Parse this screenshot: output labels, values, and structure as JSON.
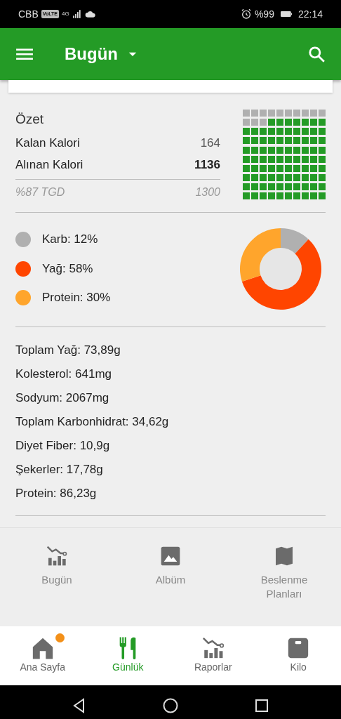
{
  "status_bar": {
    "carrier": "CBB",
    "volte": "VoLTE",
    "network": "4G",
    "battery_text": "%99",
    "time": "22:14"
  },
  "app_bar": {
    "title": "Bugün"
  },
  "summary": {
    "title": "Özet",
    "rows": [
      {
        "label": "Kalan Kalori",
        "value": "164",
        "emphasis": false
      },
      {
        "label": "Alınan Kalori",
        "value": "1136",
        "emphasis": true
      }
    ],
    "footer_label": "%87 TGD",
    "footer_value": "1300"
  },
  "macros": {
    "items": [
      {
        "label": "Karb: 12%",
        "color": "#b0b0b0"
      },
      {
        "label": "Yağ: 58%",
        "color": "#ff4500"
      },
      {
        "label": "Protein: 30%",
        "color": "#ffa52c"
      }
    ],
    "chart_data": {
      "type": "donut",
      "values": [
        12,
        58,
        30
      ]
    }
  },
  "nutrients": [
    "Toplam Yağ: 73,89g",
    "Kolesterol: 641mg",
    "Sodyum: 2067mg",
    "Toplam Karbonhidrat: 34,62g",
    "Diyet Fiber: 10,9g",
    "Şekerler: 17,78g",
    "Protein: 86,23g"
  ],
  "shortcuts": [
    {
      "label": "Bugün",
      "kind": "chart"
    },
    {
      "label": "Albüm",
      "kind": "image"
    },
    {
      "label": "Beslenme Planları",
      "kind": "map"
    }
  ],
  "bottom_nav": [
    {
      "label": "Ana Sayfa",
      "kind": "home",
      "selected": false,
      "badge": true
    },
    {
      "label": "Günlük",
      "kind": "food",
      "selected": true,
      "badge": false
    },
    {
      "label": "Raporlar",
      "kind": "chart",
      "selected": false,
      "badge": false
    },
    {
      "label": "Kilo",
      "kind": "scale",
      "selected": false,
      "badge": false
    }
  ]
}
